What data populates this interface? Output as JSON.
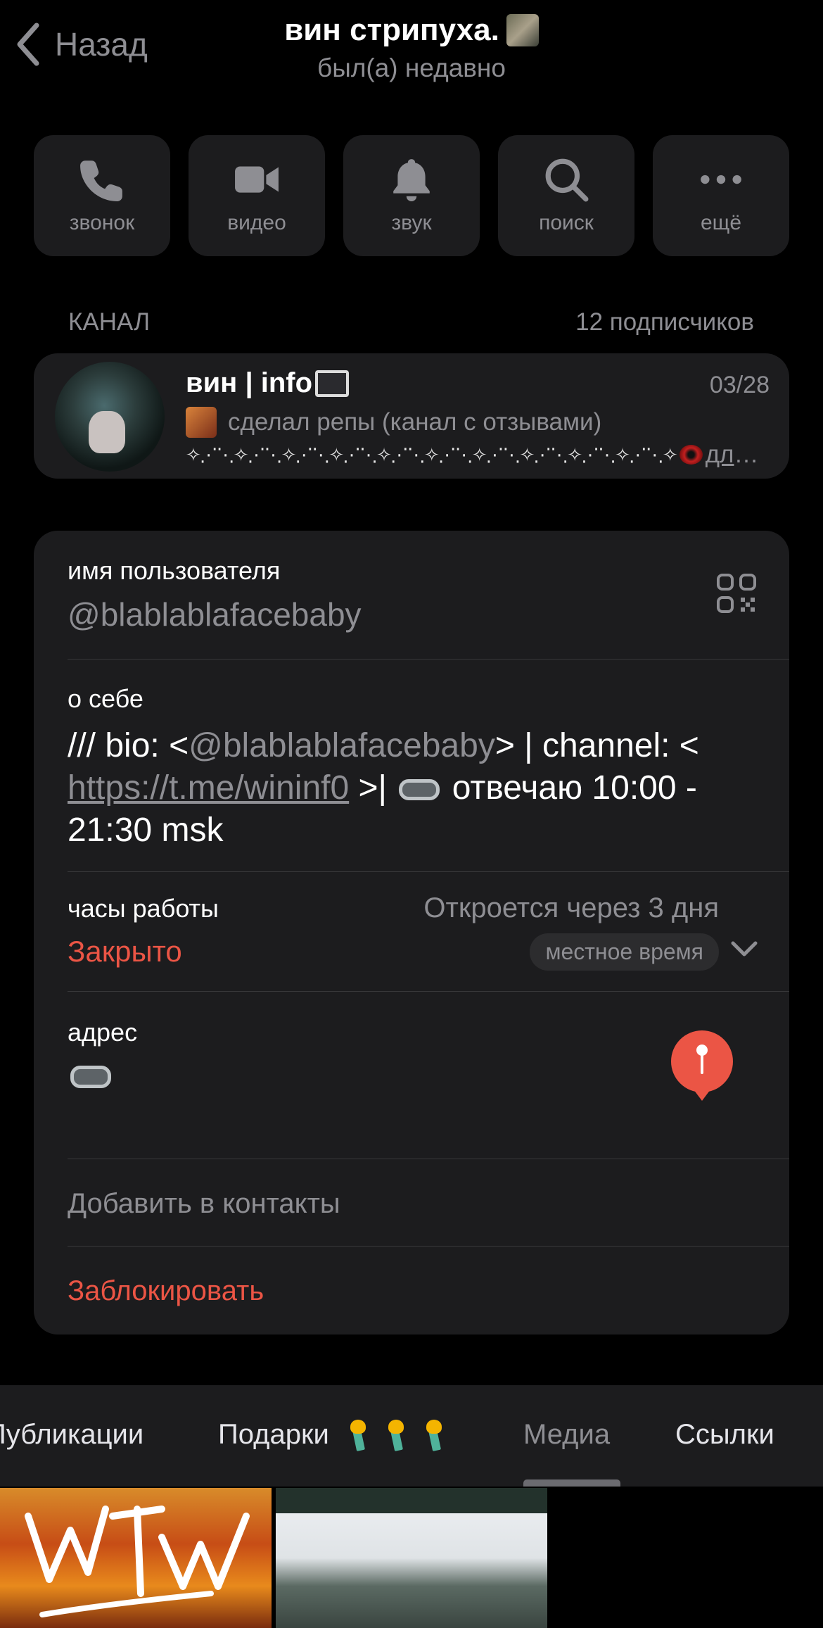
{
  "header": {
    "back_label": "Назад",
    "title": "вин стрипуха.",
    "status": "был(а) недавно"
  },
  "actions": [
    {
      "label": "звонок",
      "icon": "phone-icon"
    },
    {
      "label": "видео",
      "icon": "video-camera-icon"
    },
    {
      "label": "звук",
      "icon": "bell-icon"
    },
    {
      "label": "поиск",
      "icon": "search-icon"
    },
    {
      "label": "ещё",
      "icon": "more-icon"
    }
  ],
  "channel": {
    "section_label": "КАНАЛ",
    "subscribers": "12 подписчиков",
    "name": "вин | info",
    "date": "03/28",
    "last_message": "сделал репы (канал с отзывами)",
    "second_line_decoration": "✧⋰⋱✧⋰⋱✧⋰⋱✧⋰⋱✧⋰⋱✧⋰⋱✧⋰⋱✧⋰⋱✧⋰⋱✧⋰⋱✧",
    "second_line_link": "для лу..."
  },
  "info": {
    "username_label": "имя пользователя",
    "username": "@blablablafacebaby",
    "bio_label": "о себе",
    "bio_prefix": "/// bio: <",
    "bio_mention": "@blablablafacebaby",
    "bio_mid": "> | channel: <",
    "bio_link": "https://t.me/wininf0",
    "bio_after_link": " >|",
    "bio_suffix": " отвечаю 10:00 - 21:30 msk",
    "hours_label": "часы работы",
    "hours_status": "Закрыто",
    "hours_next": "Откроется через 3 дня",
    "hours_local": "местное время",
    "address_label": "адрес",
    "add_contact": "Добавить в контакты",
    "block": "Заблокировать"
  },
  "tabs": [
    {
      "label": "Публикации",
      "active": false
    },
    {
      "label": "Подарки",
      "active": false
    },
    {
      "label": "Медиа",
      "active": true
    },
    {
      "label": "Ссылки",
      "active": false
    }
  ],
  "colors": {
    "background": "#000000",
    "card": "#1c1c1e",
    "secondary_text": "#8e8e93",
    "destructive": "#eb5545"
  }
}
